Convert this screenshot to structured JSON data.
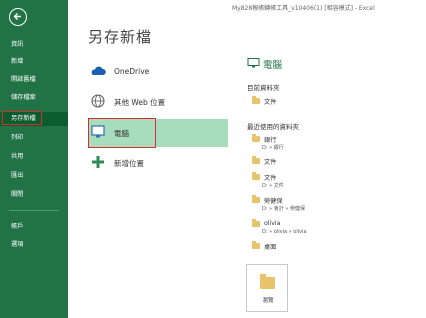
{
  "window": {
    "title": "My828報帳轉帳工具_v10406(1) [相容模式] - Excel"
  },
  "sidebar": {
    "items": [
      {
        "label": "資訊"
      },
      {
        "label": "新增"
      },
      {
        "label": "開啟舊檔"
      },
      {
        "label": "儲存檔案"
      },
      {
        "label": "另存新檔"
      },
      {
        "label": "列印"
      },
      {
        "label": "共用"
      },
      {
        "label": "匯出"
      },
      {
        "label": "關閉"
      },
      {
        "label": "帳戶"
      },
      {
        "label": "選項"
      }
    ]
  },
  "main": {
    "title": "另存新檔",
    "places": [
      {
        "label": "OneDrive",
        "icon": "cloud-icon"
      },
      {
        "label": "其他 Web 位置",
        "icon": "globe-icon"
      },
      {
        "label": "電腦",
        "icon": "computer-icon"
      },
      {
        "label": "新增位置",
        "icon": "plus-icon"
      }
    ]
  },
  "right": {
    "title": "電腦",
    "current_label": "目前資料夾",
    "current_folder": {
      "name": "文件"
    },
    "recent_label": "最近使用的資料夾",
    "recent": [
      {
        "name": "銀行",
        "path": "D: » 銀行"
      },
      {
        "name": "文件",
        "path": ""
      },
      {
        "name": "文件",
        "path": "D: » 文件"
      },
      {
        "name": "勞健保",
        "path": "D: » 會計 » 勞健保"
      },
      {
        "name": "olivia",
        "path": "D: » olivia » olivia"
      },
      {
        "name": "桌面",
        "path": ""
      }
    ],
    "browse_label": "瀏覽"
  },
  "colors": {
    "accent": "#217346",
    "selected": "#a7dcbc",
    "highlight": "#d0312d"
  }
}
